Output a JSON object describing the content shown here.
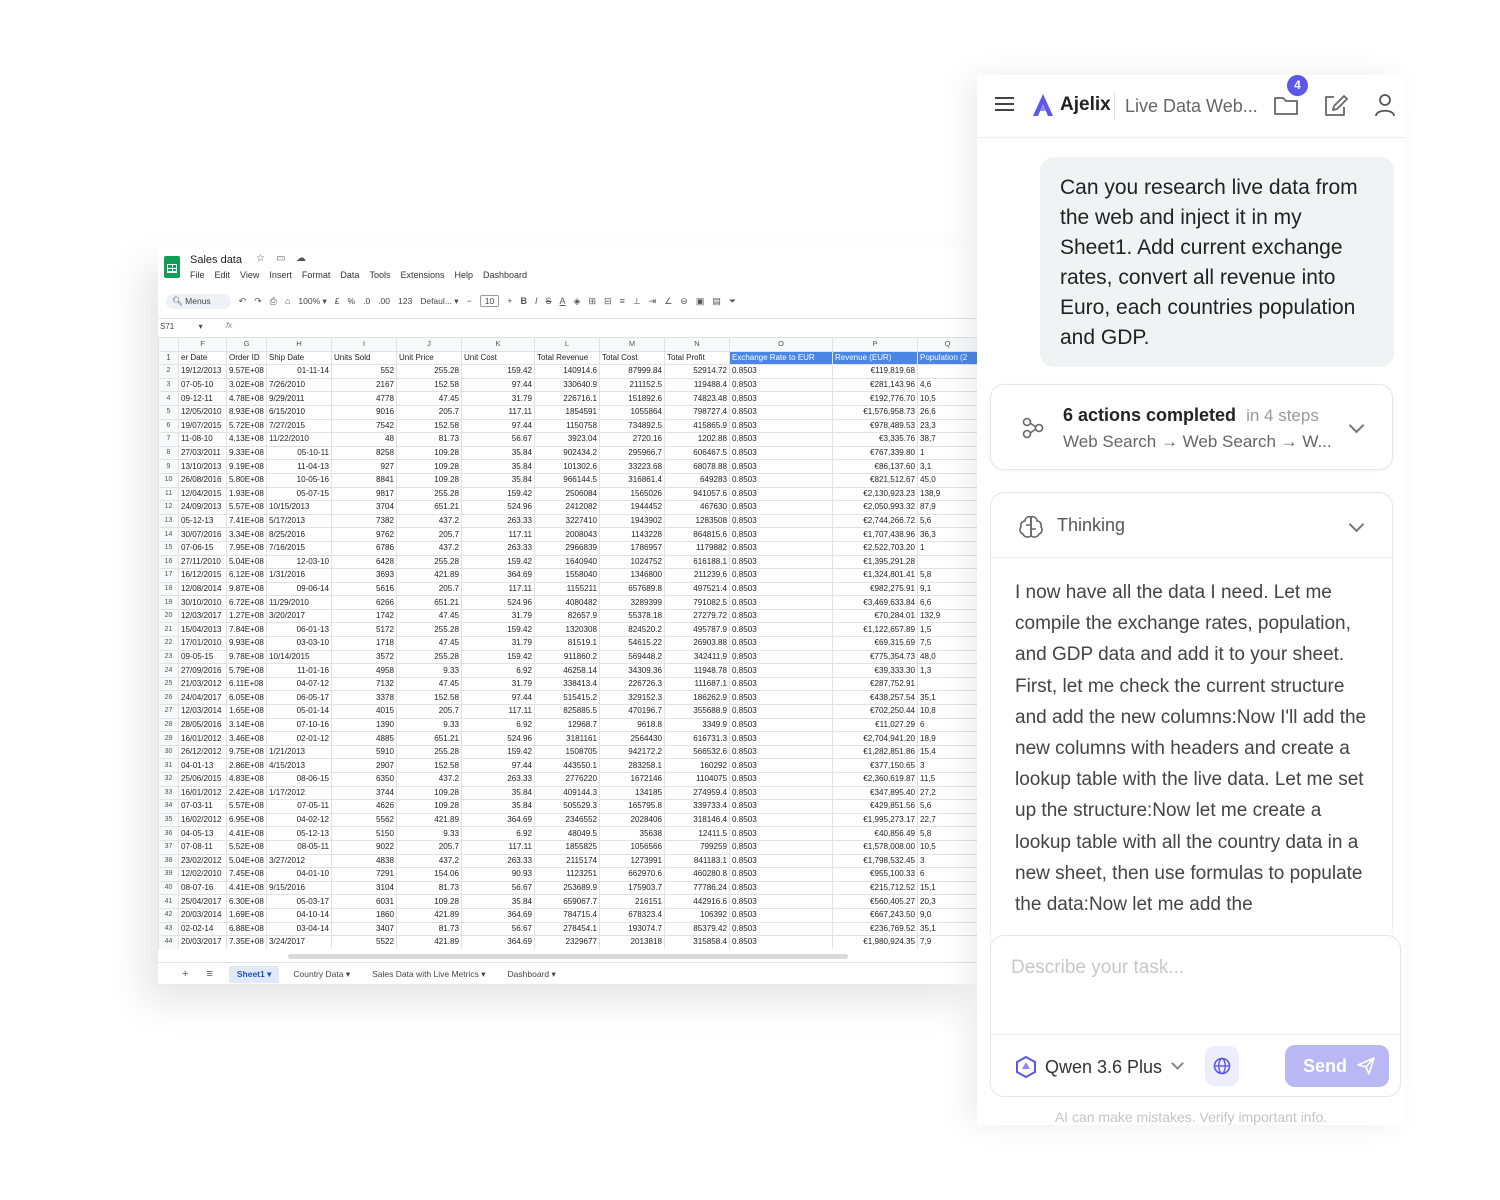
{
  "sheet": {
    "title": "Sales data",
    "menu": [
      "File",
      "Edit",
      "View",
      "Insert",
      "Format",
      "Data",
      "Tools",
      "Extensions",
      "Help",
      "Dashboard"
    ],
    "toolbar": {
      "search": "Menus",
      "zoom": "100%",
      "currency": "£",
      "percent": "%",
      "dec_dec": ".0",
      "dec_inc": ".00",
      "format123": "123",
      "font": "Defaul...",
      "font_size": "10"
    },
    "cell_ref": "S71",
    "fx": "fx",
    "col_letters": [
      "F",
      "G",
      "H",
      "I",
      "J",
      "K",
      "L",
      "M",
      "N",
      "O",
      "P",
      "Q"
    ],
    "headers": [
      "er Date",
      "Order ID",
      "Ship Date",
      "Units Sold",
      "Unit Price",
      "Unit Cost",
      "Total Revenue",
      "Total Cost",
      "Total Profit",
      "Exchange Rate to EUR",
      "Revenue (EUR)",
      "Population (2"
    ],
    "rows": [
      [
        "19/12/2013",
        "9.57E+08",
        "01-11-14",
        "552",
        "255.28",
        "159.42",
        "140914.6",
        "87999.84",
        "52914.72",
        "0.8503",
        "€119,819.68",
        ""
      ],
      [
        "07-05-10",
        "3.02E+08",
        "7/26/2010",
        "2167",
        "152.58",
        "97.44",
        "330640.9",
        "211152.5",
        "119488.4",
        "0.8503",
        "€281,143.96",
        "4,6"
      ],
      [
        "09-12-11",
        "4.78E+08",
        "9/29/2011",
        "4778",
        "47.45",
        "31.79",
        "226716.1",
        "151892.6",
        "74823.48",
        "0.8503",
        "€192,776.70",
        "10,5"
      ],
      [
        "12/05/2010",
        "8.93E+08",
        "6/15/2010",
        "9016",
        "205.7",
        "117.11",
        "1854591",
        "1055864",
        "798727.4",
        "0.8503",
        "€1,576,958.73",
        "26,6"
      ],
      [
        "19/07/2015",
        "5.72E+08",
        "7/27/2015",
        "7542",
        "152.58",
        "97.44",
        "1150758",
        "734892.5",
        "415865.9",
        "0.8503",
        "€978,489.53",
        "23,3"
      ],
      [
        "11-08-10",
        "4.13E+08",
        "11/22/2010",
        "48",
        "81.73",
        "56.67",
        "3923.04",
        "2720.16",
        "1202.88",
        "0.8503",
        "€3,335.76",
        "38,7"
      ],
      [
        "27/03/2011",
        "9.33E+08",
        "05-10-11",
        "8258",
        "109.28",
        "35.84",
        "902434.2",
        "295966.7",
        "606467.5",
        "0.8503",
        "€767,339.80",
        "1"
      ],
      [
        "13/10/2013",
        "9.19E+08",
        "11-04-13",
        "927",
        "109.28",
        "35.84",
        "101302.6",
        "33223.68",
        "68078.88",
        "0.8503",
        "€86,137.60",
        "3,1"
      ],
      [
        "26/08/2016",
        "5.80E+08",
        "10-05-16",
        "8841",
        "109.28",
        "35.84",
        "966144.5",
        "316861.4",
        "649283",
        "0.8503",
        "€821,512.67",
        "45,0"
      ],
      [
        "12/04/2015",
        "1.93E+08",
        "05-07-15",
        "9817",
        "255.28",
        "159.42",
        "2506084",
        "1565026",
        "941057.6",
        "0.8503",
        "€2,130,923.23",
        "138,9"
      ],
      [
        "24/09/2013",
        "5.57E+08",
        "10/15/2013",
        "3704",
        "651.21",
        "524.96",
        "2412082",
        "1944452",
        "467630",
        "0.8503",
        "€2,050,993.32",
        "87,9"
      ],
      [
        "05-12-13",
        "7.41E+08",
        "5/17/2013",
        "7382",
        "437.2",
        "263.33",
        "3227410",
        "1943902",
        "1283508",
        "0.8503",
        "€2,744,266.72",
        "5,6"
      ],
      [
        "30/07/2016",
        "3.34E+08",
        "8/25/2016",
        "9762",
        "205.7",
        "117.11",
        "2008043",
        "1143228",
        "864815.6",
        "0.8503",
        "€1,707,438.96",
        "36,3"
      ],
      [
        "07-06-15",
        "7.95E+08",
        "7/16/2015",
        "6786",
        "437.2",
        "263.33",
        "2966839",
        "1786957",
        "1179882",
        "0.8503",
        "€2,522,703.20",
        "1"
      ],
      [
        "27/11/2010",
        "5.04E+08",
        "12-03-10",
        "6428",
        "255.28",
        "159.42",
        "1640940",
        "1024752",
        "616188.1",
        "0.8503",
        "€1,395,291.28",
        ""
      ],
      [
        "16/12/2015",
        "6.12E+08",
        "1/31/2016",
        "3693",
        "421.89",
        "364.69",
        "1558040",
        "1346800",
        "211239.6",
        "0.8503",
        "€1,324,801.41",
        "5,8"
      ],
      [
        "12/08/2014",
        "9.87E+08",
        "09-06-14",
        "5616",
        "205.7",
        "117.11",
        "1155211",
        "657689.8",
        "497521.4",
        "0.8503",
        "€982,275.91",
        "9,1"
      ],
      [
        "30/10/2010",
        "6.72E+08",
        "11/29/2010",
        "6266",
        "651.21",
        "524.96",
        "4080482",
        "3289399",
        "791082.5",
        "0.8503",
        "€3,469,633.84",
        "6,6"
      ],
      [
        "12/03/2017",
        "1.27E+08",
        "3/20/2017",
        "1742",
        "47.45",
        "31.79",
        "82657.9",
        "55378.18",
        "27279.72",
        "0.8503",
        "€70,284.01",
        "132,9"
      ],
      [
        "15/04/2013",
        "7.84E+08",
        "06-01-13",
        "5172",
        "255.28",
        "159.42",
        "1320308",
        "824520.2",
        "495787.9",
        "0.8503",
        "€1,122,657.89",
        "1,5"
      ],
      [
        "17/01/2010",
        "9.93E+08",
        "03-03-10",
        "1718",
        "47.45",
        "31.79",
        "81519.1",
        "54615.22",
        "26903.88",
        "0.8503",
        "€69,315.69",
        "7,5"
      ],
      [
        "09-05-15",
        "9.78E+08",
        "10/14/2015",
        "3572",
        "255.28",
        "159.42",
        "911860.2",
        "569448.2",
        "342411.9",
        "0.8503",
        "€775,354.73",
        "48,0"
      ],
      [
        "27/09/2016",
        "5.79E+08",
        "11-01-16",
        "4958",
        "9.33",
        "6.92",
        "46258.14",
        "34309.36",
        "11948.78",
        "0.8503",
        "€39,333.30",
        "1,3"
      ],
      [
        "21/03/2012",
        "6.11E+08",
        "04-07-12",
        "7132",
        "47.45",
        "31.79",
        "338413.4",
        "226726.3",
        "111687.1",
        "0.8503",
        "€287,752.91",
        ""
      ],
      [
        "24/04/2017",
        "6.05E+08",
        "06-05-17",
        "3378",
        "152.58",
        "97.44",
        "515415.2",
        "329152.3",
        "186262.9",
        "0.8503",
        "€438,257.54",
        "35,1"
      ],
      [
        "12/03/2014",
        "1.65E+08",
        "05-01-14",
        "4015",
        "205.7",
        "117.11",
        "825885.5",
        "470196.7",
        "355688.9",
        "0.8503",
        "€702,250.44",
        "10,8"
      ],
      [
        "28/05/2016",
        "3.14E+08",
        "07-10-16",
        "1390",
        "9.33",
        "6.92",
        "12968.7",
        "9618.8",
        "3349.9",
        "0.8503",
        "€11,027.29",
        "6"
      ],
      [
        "16/01/2012",
        "3.46E+08",
        "02-01-12",
        "4885",
        "651.21",
        "524.96",
        "3181161",
        "2564430",
        "616731.3",
        "0.8503",
        "€2,704,941.20",
        "18,9"
      ],
      [
        "26/12/2012",
        "9.75E+08",
        "1/21/2013",
        "5910",
        "255.28",
        "159.42",
        "1508705",
        "942172.2",
        "566532.6",
        "0.8503",
        "€1,282,851.86",
        "15,4"
      ],
      [
        "04-01-13",
        "2.86E+08",
        "4/15/2013",
        "2907",
        "152.58",
        "97.44",
        "443550.1",
        "283258.1",
        "160292",
        "0.8503",
        "€377,150.65",
        "3"
      ],
      [
        "25/06/2015",
        "4.83E+08",
        "08-06-15",
        "6350",
        "437.2",
        "263.33",
        "2776220",
        "1672146",
        "1104075",
        "0.8503",
        "€2,360,619.87",
        "11,5"
      ],
      [
        "16/01/2012",
        "2.42E+08",
        "1/17/2012",
        "3744",
        "109.28",
        "35.84",
        "409144.3",
        "134185",
        "274959.4",
        "0.8503",
        "€347,895.40",
        "27,2"
      ],
      [
        "07-03-11",
        "5.57E+08",
        "07-05-11",
        "4626",
        "109.28",
        "35.84",
        "505529.3",
        "165795.8",
        "339733.4",
        "0.8503",
        "€429,851.56",
        "5,6"
      ],
      [
        "16/02/2012",
        "6.95E+08",
        "04-02-12",
        "5562",
        "421.89",
        "364.69",
        "2346552",
        "2028406",
        "318146.4",
        "0.8503",
        "€1,995,273.17",
        "22,7"
      ],
      [
        "04-05-13",
        "4.41E+08",
        "05-12-13",
        "5150",
        "9.33",
        "6.92",
        "48049.5",
        "35638",
        "12411.5",
        "0.8503",
        "€40,856.49",
        "5,8"
      ],
      [
        "07-08-11",
        "5.52E+08",
        "08-05-11",
        "9022",
        "205.7",
        "117.11",
        "1855825",
        "1056566",
        "799259",
        "0.8503",
        "€1,578,008.00",
        "10,5"
      ],
      [
        "23/02/2012",
        "5.04E+08",
        "3/27/2012",
        "4838",
        "437.2",
        "263.33",
        "2115174",
        "1273991",
        "841183.1",
        "0.8503",
        "€1,798,532.45",
        "3"
      ],
      [
        "12/02/2010",
        "7.45E+08",
        "04-01-10",
        "7291",
        "154.06",
        "90.93",
        "1123251",
        "662970.6",
        "460280.8",
        "0.8503",
        "€955,100.33",
        "6"
      ],
      [
        "08-07-16",
        "4.41E+08",
        "9/15/2016",
        "3104",
        "81.73",
        "56.67",
        "253689.9",
        "175903.7",
        "77786.24",
        "0.8503",
        "€215,712.52",
        "15,1"
      ],
      [
        "25/04/2017",
        "6.30E+08",
        "05-03-17",
        "6031",
        "109.28",
        "35.84",
        "659067.7",
        "216151",
        "442916.6",
        "0.8503",
        "€560,405.27",
        "20,3"
      ],
      [
        "20/03/2014",
        "1.69E+08",
        "04-10-14",
        "1860",
        "421.89",
        "364.69",
        "784715.4",
        "678323.4",
        "106392",
        "0.8503",
        "€667,243.50",
        "9,0"
      ],
      [
        "02-02-14",
        "6.88E+08",
        "03-04-14",
        "3407",
        "81.73",
        "56.67",
        "278454.1",
        "193074.7",
        "85379.42",
        "0.8503",
        "€236,769.52",
        "35,1"
      ],
      [
        "20/03/2017",
        "7.35E+08",
        "3/24/2017",
        "5522",
        "421.89",
        "364.69",
        "2329677",
        "2013818",
        "315858.4",
        "0.8503",
        "€1,980,924.35",
        "7,9"
      ]
    ],
    "tabs": [
      "Sheet1",
      "Country Data",
      "Sales Data with Live Metrics",
      "Dashboard"
    ]
  },
  "panel": {
    "brand": "Ajelix",
    "chat_title": "Live Data Web...",
    "badge_count": "4",
    "user_message": "Can you research live data from the web and inject it in my Sheet1. Add current exchange rates, convert all revenue into Euro, each countries population and GDP.",
    "actions": {
      "title": "6 actions completed",
      "steps": "in 4 steps",
      "subtitle": "Web Search → Web Search → W..."
    },
    "thinking": {
      "label": "Thinking",
      "text": "I now have all the data I need. Let me compile the exchange rates, population, and GDP data and add it to your sheet. First, let me check the current structure and add the new columns:Now I'll add the new columns with headers and create a lookup table with the live data. Let me set up the structure:Now let me create a lookup table with all the country data in a new sheet, then use formulas to populate the data:Now let me add the"
    },
    "input_placeholder": "Describe your task...",
    "model": "Qwen 3.6 Plus",
    "send_label": "Send",
    "disclaimer": "AI can make mistakes. Verify important info.",
    "accent": "#5b57e8"
  }
}
